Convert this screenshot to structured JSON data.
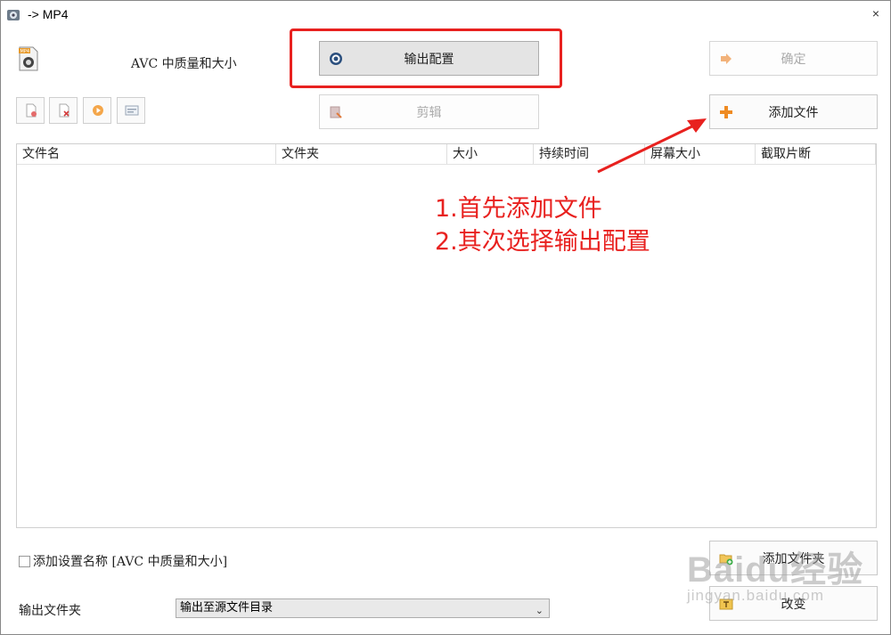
{
  "window": {
    "title": "-> MP4",
    "close_label": "×"
  },
  "profile": {
    "label": "AVC 中质量和大小"
  },
  "buttons": {
    "output_config": "输出配置",
    "ok": "确定",
    "edit": "剪辑",
    "add_file": "添加文件",
    "add_folder": "添加文件夹",
    "change": "改变"
  },
  "toolbar_icons": [
    "remove-file-icon",
    "clear-list-icon",
    "play-icon",
    "media-info-icon"
  ],
  "table": {
    "columns": [
      "文件名",
      "文件夹",
      "大小",
      "持续时间",
      "屏幕大小",
      "截取片断"
    ],
    "rows": []
  },
  "options": {
    "add_setting_name": "添加设置名称 [AVC 中质量和大小]",
    "add_setting_checked": false,
    "output_folder_label": "输出文件夹",
    "output_folder_value": "输出至源文件目录"
  },
  "annotation": {
    "line1": "1.首先添加文件",
    "line2": "2.其次选择输出配置",
    "color": "#e8211f"
  },
  "watermark": {
    "brand": "Baidu经验",
    "url": "jingyan.baidu.com"
  }
}
